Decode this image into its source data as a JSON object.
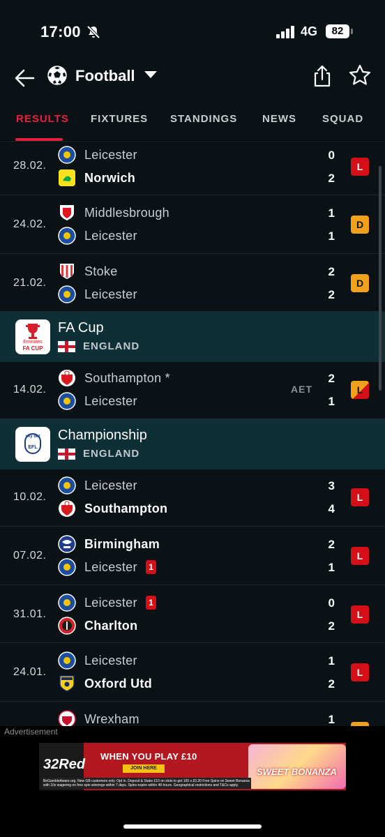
{
  "status_bar": {
    "time": "17:00",
    "network": "4G",
    "battery": "82"
  },
  "header": {
    "title": "Football"
  },
  "tabs": [
    "RESULTS",
    "FIXTURES",
    "STANDINGS",
    "NEWS",
    "SQUAD"
  ],
  "matches_top": [
    {
      "date": "28.02.",
      "home": "Leicester",
      "away": "Norwich",
      "home_score": "0",
      "away_score": "2",
      "result": "L",
      "bold": "away",
      "home_crest": "leicester-crest",
      "away_crest": "norwich-crest"
    },
    {
      "date": "24.02.",
      "home": "Middlesbrough",
      "away": "Leicester",
      "home_score": "1",
      "away_score": "1",
      "result": "D",
      "bold": "",
      "home_crest": "middlesbrough-crest",
      "away_crest": "leicester-crest"
    },
    {
      "date": "21.02.",
      "home": "Stoke",
      "away": "Leicester",
      "home_score": "2",
      "away_score": "2",
      "result": "D",
      "bold": "",
      "home_crest": "stoke-crest",
      "away_crest": "leicester-crest"
    }
  ],
  "competition_fa": {
    "name": "FA Cup",
    "country": "ENGLAND",
    "logo_text_1": "Emirates",
    "logo_text_2": "FA CUP"
  },
  "match_fa": {
    "date": "14.02.",
    "home": "Southampton *",
    "away": "Leicester",
    "home_score": "2",
    "away_score": "1",
    "note": "AET",
    "result": "L"
  },
  "competition_ch": {
    "name": "Championship",
    "country": "ENGLAND",
    "logo_text_1": "sky bet",
    "logo_text_2": "EFL"
  },
  "matches_bottom": [
    {
      "date": "10.02.",
      "home": "Leicester",
      "away": "Southampton",
      "home_score": "3",
      "away_score": "4",
      "result": "L",
      "bold": "away",
      "red_card": ""
    },
    {
      "date": "07.02.",
      "home": "Birmingham",
      "away": "Leicester",
      "home_score": "2",
      "away_score": "1",
      "result": "L",
      "bold": "home",
      "red_card": "1"
    },
    {
      "date": "31.01.",
      "home": "Leicester",
      "away": "Charlton",
      "home_score": "0",
      "away_score": "2",
      "result": "L",
      "bold": "away",
      "red_card": "1"
    },
    {
      "date": "24.01.",
      "home": "Leicester",
      "away": "Oxford Utd",
      "home_score": "1",
      "away_score": "2",
      "result": "L",
      "bold": "away",
      "red_card": ""
    },
    {
      "date": "",
      "home": "Wrexham",
      "away": "",
      "home_score": "1",
      "away_score": "",
      "result": "",
      "bold": "",
      "red_card": ""
    }
  ],
  "ad": {
    "label": "Advertisement",
    "brand": "32Red",
    "headline": "WHEN YOU PLAY £10",
    "cta": "JOIN HERE",
    "game": "SWEET BONANZA",
    "small_print": "BeGambleAware.org. New GB customers only. Opt in. Deposit & Stake £10 on slots to get 100 x £0.20 Free Spins on Sweet Bonanza with 10x wagering on free spin winnings within 7 days. Spins expire within 48 hours. Geographical restrictions and T&Cs apply."
  },
  "colors": {
    "accent": "#e8203e",
    "loss": "#d40f18",
    "draw": "#f2a11a",
    "background": "#0b1216",
    "competition_bg": "#0e2f36"
  }
}
